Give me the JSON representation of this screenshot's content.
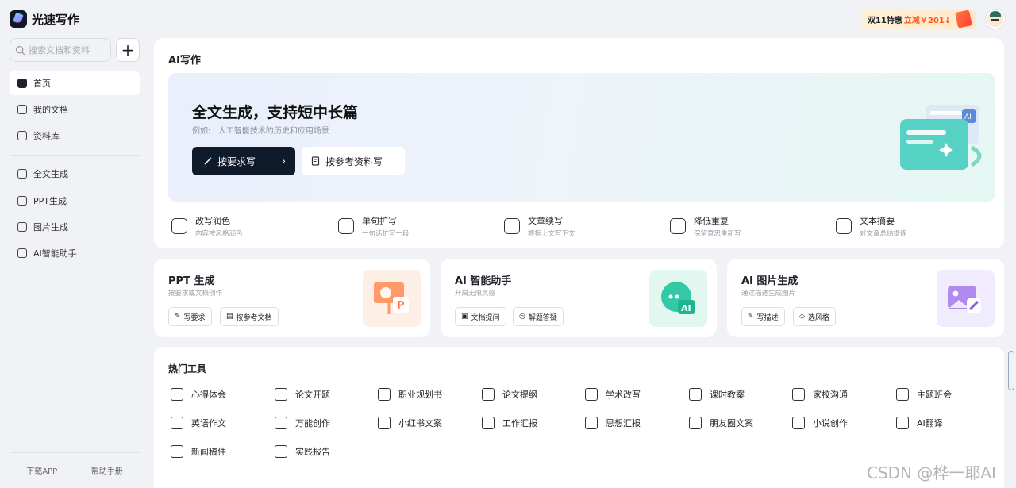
{
  "app": {
    "name": "光速写作"
  },
  "promo": {
    "prefix": "双11特惠",
    "highlight": "立减￥201↓"
  },
  "sidebar": {
    "search_placeholder": "搜索文档和资料",
    "plus": "+",
    "top_items": [
      {
        "label": "首页",
        "icon": "home-icon"
      },
      {
        "label": "我的文档",
        "icon": "document-icon"
      },
      {
        "label": "资料库",
        "icon": "library-icon"
      }
    ],
    "tool_items": [
      {
        "label": "全文生成",
        "icon": "full-text-icon"
      },
      {
        "label": "PPT生成",
        "icon": "ppt-icon"
      },
      {
        "label": "图片生成",
        "icon": "image-icon"
      },
      {
        "label": "AI智能助手",
        "icon": "assistant-icon"
      }
    ],
    "footer": {
      "download": "下载APP",
      "help": "帮助手册"
    }
  },
  "ai_writing": {
    "title": "AI写作",
    "hero": {
      "title": "全文生成，支持短中长篇",
      "example_label": "例如:",
      "example": "人工智能技术的历史和应用场景",
      "primary_button": "按要求写",
      "secondary_button": "按参考资料写"
    },
    "tools": [
      {
        "name": "改写润色",
        "desc": "内容按风格润色"
      },
      {
        "name": "单句扩写",
        "desc": "一句话扩写一段"
      },
      {
        "name": "文章续写",
        "desc": "根据上文写下文"
      },
      {
        "name": "降低重复",
        "desc": "保留意思重新写"
      },
      {
        "name": "文本摘要",
        "desc": "对文章总结提炼"
      }
    ]
  },
  "mini_cards": [
    {
      "title": "PPT 生成",
      "sub": "按要求或文档创作",
      "buttons": [
        "写要求",
        "按参考文档"
      ]
    },
    {
      "title": "AI 智能助手",
      "sub": "开启无限灵感",
      "buttons": [
        "文档提问",
        "解题答疑"
      ]
    },
    {
      "title": "AI 图片生成",
      "sub": "通过描述生成图片",
      "buttons": [
        "写描述",
        "选风格"
      ]
    }
  ],
  "hot_tools": {
    "title": "热门工具",
    "items": [
      "心得体会",
      "论文开题",
      "职业规划书",
      "论文提纲",
      "学术改写",
      "课时教案",
      "家校沟通",
      "主题班会",
      "英语作文",
      "万能创作",
      "小红书文案",
      "工作汇报",
      "思想汇报",
      "朋友圈文案",
      "小说创作",
      "AI翻译",
      "新闻稿件",
      "实践报告"
    ]
  },
  "watermark": "CSDN @桦一耶AI"
}
